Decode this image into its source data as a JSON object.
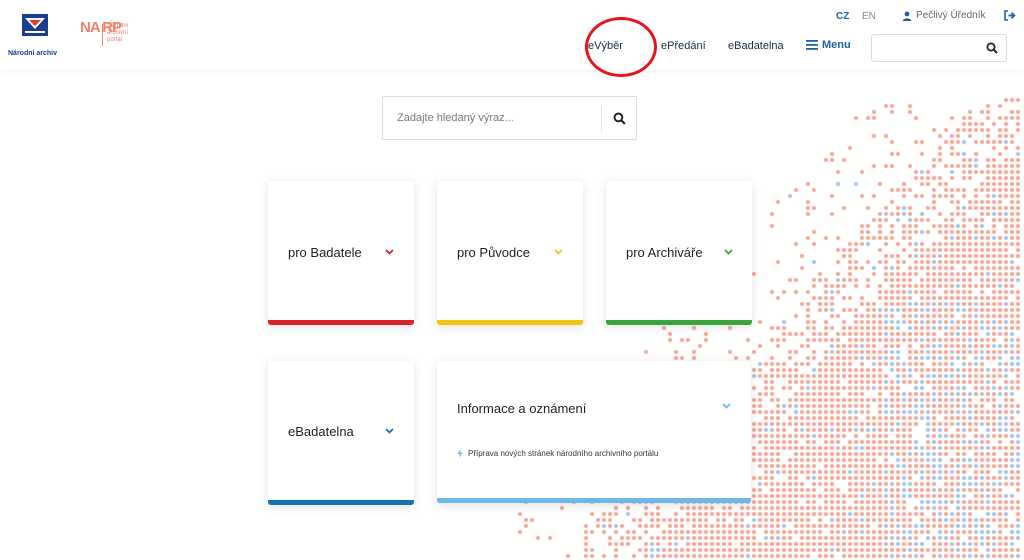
{
  "header": {
    "logo_primary": {
      "label": "Národní archiv"
    },
    "logo_secondary": {
      "mark": "NA RP",
      "text_lines": [
        "Národní",
        "archivní",
        "portál"
      ]
    },
    "languages": [
      "CZ",
      "EN"
    ],
    "active_language": "CZ",
    "user_name": "Pečlivý Úředník",
    "nav": [
      {
        "label": "eVýběr",
        "highlighted": true
      },
      {
        "label": "ePředání"
      },
      {
        "label": "eBadatelna"
      }
    ],
    "menu_label": "Menu",
    "search_value": ""
  },
  "search": {
    "placeholder": "Zadajte hledaný výraz..."
  },
  "cards": [
    {
      "title": "pro Badatele",
      "color": "#d7232b"
    },
    {
      "title": "pro Původce",
      "color": "#f1c40f"
    },
    {
      "title": "pro Archiváře",
      "color": "#3aa53a"
    },
    {
      "title": "eBadatelna",
      "color": "#1572b8"
    },
    {
      "title": "Informace a oznámení",
      "color": "#6cb8e6",
      "news": [
        {
          "text": "Příprava nových stránek národního archivního portálu"
        }
      ]
    }
  ],
  "colors": {
    "brand_blue": "#1b3d8f",
    "accent_blue": "#1f62a8",
    "dot_salmon": "#f2a090",
    "dot_blue": "#9ec1e6",
    "highlight_red": "#e8141c"
  },
  "icons": [
    "search-icon",
    "user-icon",
    "logout-icon",
    "hamburger-icon",
    "chevron-down-icon",
    "lightning-icon"
  ]
}
